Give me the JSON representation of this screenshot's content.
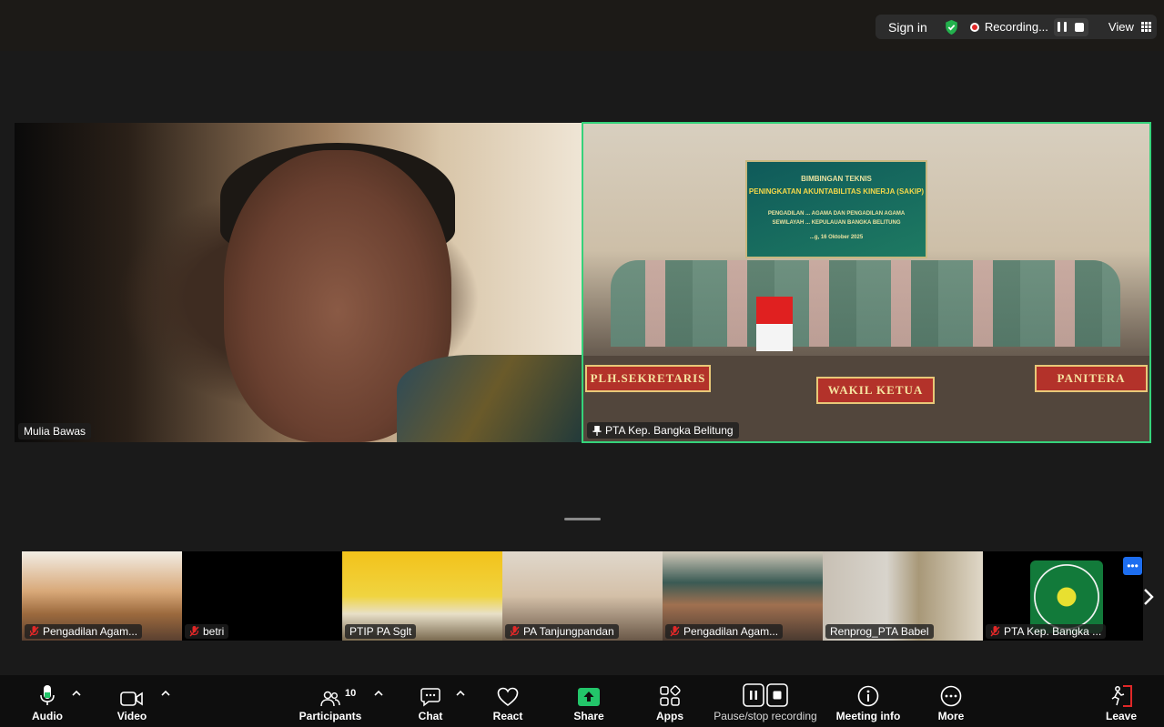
{
  "topbar": {
    "signin_label": "Sign in",
    "recording_label": "Recording...",
    "view_label": "View",
    "colors": {
      "shield": "#23b14d",
      "rec_dot": "#e02828"
    },
    "icons": [
      "shield-check-icon",
      "recording-dot-icon",
      "pause-icon",
      "stop-icon",
      "grid-view-icon"
    ]
  },
  "main_tiles": [
    {
      "name": "Mulia Bawas"
    },
    {
      "name": "PTA Kep. Bangka Belitung",
      "pinned": true,
      "banner": {
        "line1": "BIMBINGAN TEKNIS",
        "line2": "PENINGKATAN AKUNTABILITAS KINERJA (SAKIP)",
        "line3": "PENGADILAN ... AGAMA DAN PENGADILAN AGAMA",
        "line4": "SEWILAYAH ... KEPULAUAN BANGKA BELITUNG",
        "line5": "...g, 16 Oktober 2025"
      },
      "nameplates": [
        "PLH.SEKRETARIS",
        "WAKIL KETUA",
        "PANITERA"
      ],
      "active_speaker_color": "#35d27a"
    }
  ],
  "thumbnails": [
    {
      "name": "Pengadilan Agam...",
      "muted": true,
      "bg": "linear-gradient(180deg,#f2ede4 0%,#d8a878 45%,#9c6a3e 70%,#5a4030 100%)"
    },
    {
      "name": "betri",
      "muted": true,
      "bg": "#000000"
    },
    {
      "name": "PTIP PA Sglt",
      "muted": false,
      "bg": "linear-gradient(180deg,#f3c21a 0%,#f0d440 50%,#e8e0c8 70%,#7a6a50 100%)"
    },
    {
      "name": "PA Tanjungpandan",
      "muted": true,
      "bg": "linear-gradient(180deg,#e0d8cc 0%,#d4c0a8 50%,#6a5848 100%)"
    },
    {
      "name": "Pengadilan Agam...",
      "muted": true,
      "bg": "linear-gradient(180deg,#d0c8b8 0%,#3a5a54 35%,#a07050 60%,#4a3a30 100%)"
    },
    {
      "name": "Renprog_PTA Babel",
      "muted": false,
      "bg": "linear-gradient(90deg,#c8c0b4 0%,#d8d4cc 40%,#a89878 60%,#e0d8c8 100%)"
    },
    {
      "name": "PTA Kep. Bangka ...",
      "muted": true,
      "bg": "#000000",
      "logo": true
    }
  ],
  "toolbar": {
    "audio_label": "Audio",
    "video_label": "Video",
    "participants_label": "Participants",
    "participants_count": "10",
    "chat_label": "Chat",
    "react_label": "React",
    "share_label": "Share",
    "apps_label": "Apps",
    "recording_label": "Pause/stop recording",
    "info_label": "Meeting info",
    "more_label": "More",
    "leave_label": "Leave",
    "colors": {
      "share": "#23c66a",
      "leave": "#e02828"
    }
  }
}
